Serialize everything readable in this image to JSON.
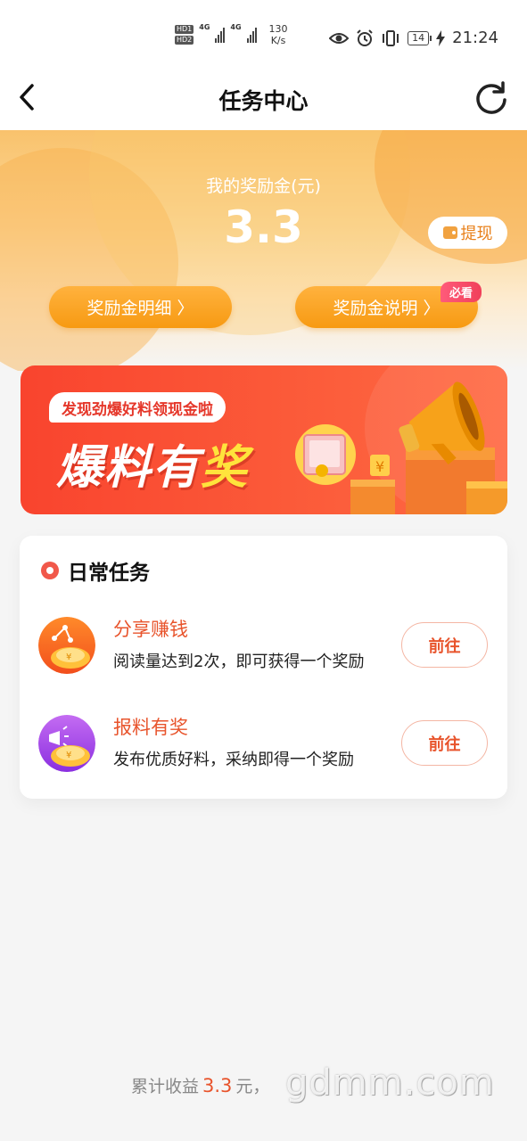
{
  "status_bar": {
    "hd1": "HD1",
    "hd2": "HD2",
    "net1": "4G",
    "net2": "4G",
    "speed_value": "130",
    "speed_unit": "K/s",
    "battery": "14",
    "time": "21:24"
  },
  "nav": {
    "title": "任务中心"
  },
  "wallet": {
    "label": "我的奖励金(元)",
    "amount": "3.3",
    "withdraw_label": "提现",
    "detail_button": "奖励金明细 〉",
    "explain_button": "奖励金说明 〉",
    "must_read_badge": "必看"
  },
  "banner": {
    "bubble_text": "发现劲爆好料领现金啦",
    "title_part1": "爆料有",
    "title_highlight": "奖"
  },
  "daily_tasks": {
    "title": "日常任务",
    "items": [
      {
        "name": "分享赚钱",
        "description": "阅读量达到2次，即可获得一个奖励",
        "button": "前往",
        "icon": "share-coin-icon"
      },
      {
        "name": "报料有奖",
        "description": "发布优质好料，采纳即得一个奖励",
        "button": "前往",
        "icon": "megaphone-coin-icon"
      }
    ]
  },
  "footer": {
    "prefix": "累计收益",
    "amount": "3.3",
    "suffix": "元，",
    "watermark": "gdmm.com"
  },
  "colors": {
    "accent_orange": "#f79a12",
    "accent_red": "#e8542c",
    "banner_red": "#f9442e"
  }
}
